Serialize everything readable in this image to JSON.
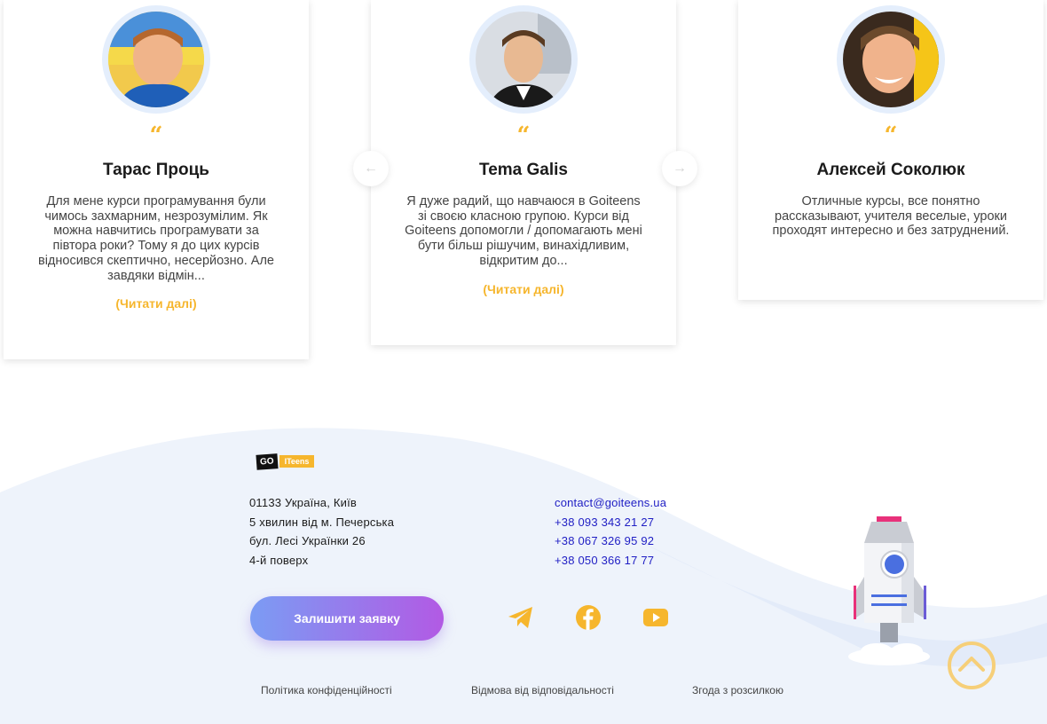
{
  "testimonials": [
    {
      "name": "Тарас Проць",
      "quote_mark": "“",
      "text": "Для мене курси програмування були чимось захмарним, незрозумілим. Як можна навчитись програмувати за півтора роки? Тому я до цих курсів відносився скептично, несерйозно. Але завдяки відмін...",
      "read_more": "(Читати далі)"
    },
    {
      "name": "Tema Galis",
      "quote_mark": "“",
      "text": "Я дуже радий, що навчаюся в Goiteens зі своєю класною групою. Курси від Goiteens допомогли / допомагають мені бути більш рішучим, винахідливим, відкритим до...",
      "read_more": "(Читати далі)"
    },
    {
      "name": "Алексей Соколюк",
      "quote_mark": "“",
      "text": "Отличные курсы, все понятно рассказывают, учителя веселые, уроки проходят интересно и без затруднений."
    }
  ],
  "slider": {
    "prev_icon": "arrow-left-icon",
    "next_icon": "arrow-right-icon",
    "prev_glyph": "←",
    "next_glyph": "→"
  },
  "footer": {
    "logo": {
      "part1": "GO",
      "part2": "ITeens"
    },
    "address": [
      "01133 Україна, Київ",
      "5 хвилин від м. Печерська",
      "бул. Лесі Українки 26",
      "4-й поверх"
    ],
    "contacts": [
      "contact@goiteens.ua",
      "+38 093 343 21 27",
      "+38 067 326 95 92",
      "+38 050 366 17 77"
    ],
    "cta_label": "Залишити заявку",
    "social": [
      "telegram-icon",
      "facebook-icon",
      "youtube-icon"
    ],
    "legal": [
      "Політика конфіденційності",
      "Відмова від відповідальності",
      "Згода з розсилкою"
    ]
  },
  "colors": {
    "accent": "#f6b62d",
    "link": "#1f1ec4",
    "cta_start": "#7b9cf4",
    "cta_end": "#b25ae4",
    "wave": "#eef3fb"
  }
}
